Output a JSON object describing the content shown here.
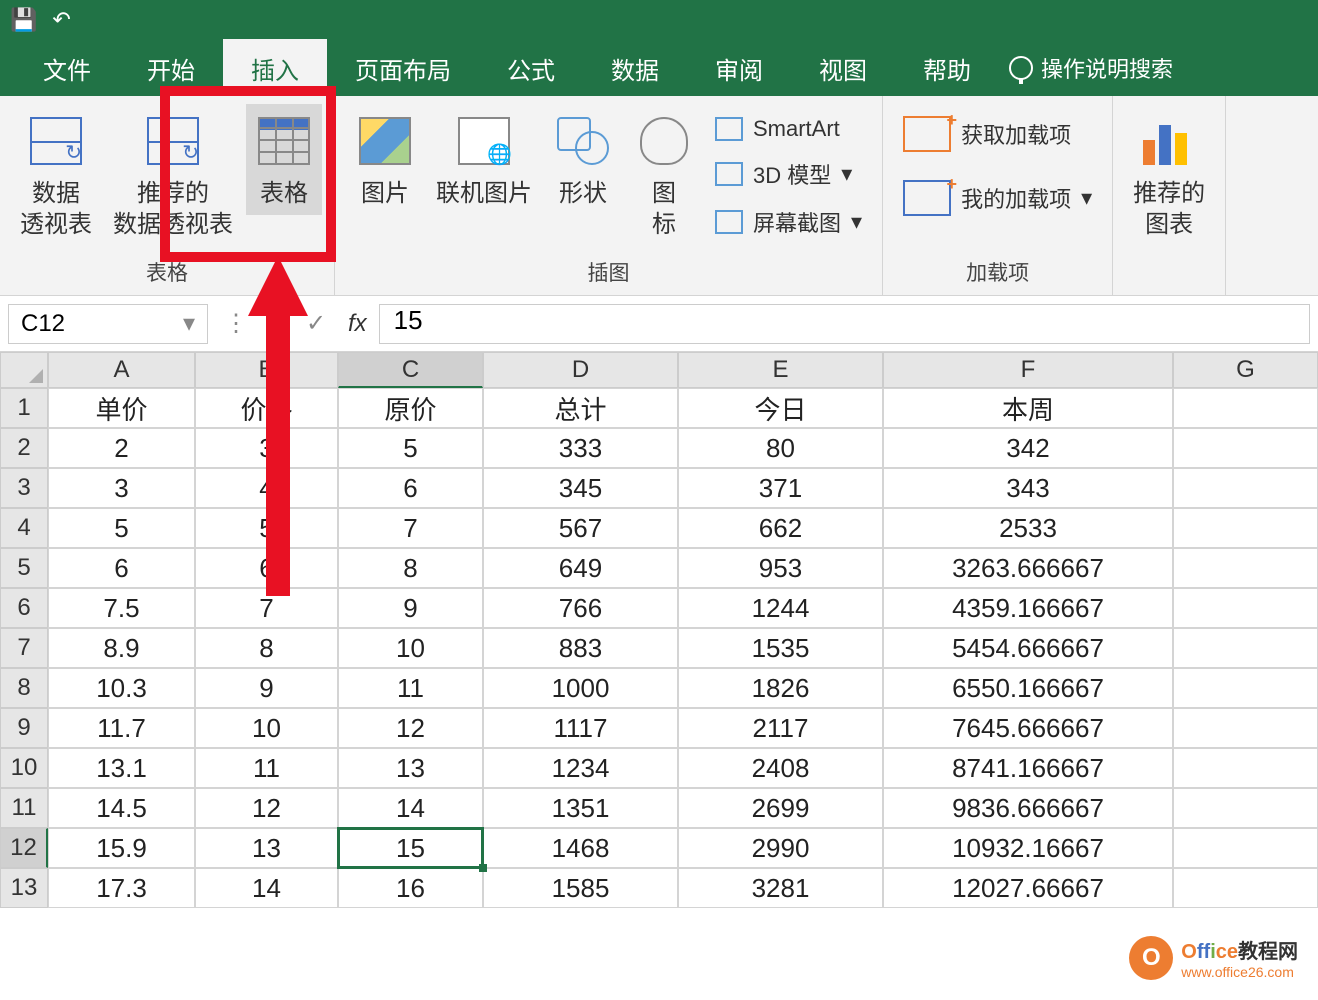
{
  "titlebar": {
    "save_icon": "💾",
    "undo_icon": "↶"
  },
  "tabs": {
    "file": "文件",
    "home": "开始",
    "insert": "插入",
    "pagelayout": "页面布局",
    "formulas": "公式",
    "data": "数据",
    "review": "审阅",
    "view": "视图",
    "help": "帮助",
    "tellme": "操作说明搜索"
  },
  "ribbon": {
    "tables": {
      "pivottable": "数据\n透视表",
      "recommended": "推荐的\n数据透视表",
      "table": "表格",
      "group": "表格"
    },
    "illustrations": {
      "picture": "图片",
      "online": "联机图片",
      "shapes": "形状",
      "icons": "图\n标",
      "smartart": "SmartArt",
      "model3d": "3D 模型",
      "screenshot": "屏幕截图",
      "group": "插图"
    },
    "addins": {
      "get": "获取加载项",
      "my": "我的加载项",
      "group": "加载项"
    },
    "charts": {
      "recommended": "推荐的\n图表"
    }
  },
  "formula_bar": {
    "name_box": "C12",
    "cancel": "✕",
    "enter": "✓",
    "fx": "fx",
    "value": "15"
  },
  "columns": [
    "A",
    "B",
    "C",
    "D",
    "E",
    "F",
    "G"
  ],
  "headers": {
    "A": "单价",
    "B": "价格",
    "C": "原价",
    "D": "总计",
    "E": "今日",
    "F": "本周"
  },
  "rows": [
    {
      "n": "1",
      "A": "单价",
      "B": "价格",
      "C": "原价",
      "D": "总计",
      "E": "今日",
      "F": "本周"
    },
    {
      "n": "2",
      "A": "2",
      "B": "3",
      "C": "5",
      "D": "333",
      "E": "80",
      "F": "342"
    },
    {
      "n": "3",
      "A": "3",
      "B": "4",
      "C": "6",
      "D": "345",
      "E": "371",
      "F": "343"
    },
    {
      "n": "4",
      "A": "5",
      "B": "5",
      "C": "7",
      "D": "567",
      "E": "662",
      "F": "2533"
    },
    {
      "n": "5",
      "A": "6",
      "B": "6",
      "C": "8",
      "D": "649",
      "E": "953",
      "F": "3263.666667"
    },
    {
      "n": "6",
      "A": "7.5",
      "B": "7",
      "C": "9",
      "D": "766",
      "E": "1244",
      "F": "4359.166667"
    },
    {
      "n": "7",
      "A": "8.9",
      "B": "8",
      "C": "10",
      "D": "883",
      "E": "1535",
      "F": "5454.666667"
    },
    {
      "n": "8",
      "A": "10.3",
      "B": "9",
      "C": "11",
      "D": "1000",
      "E": "1826",
      "F": "6550.166667"
    },
    {
      "n": "9",
      "A": "11.7",
      "B": "10",
      "C": "12",
      "D": "1117",
      "E": "2117",
      "F": "7645.666667"
    },
    {
      "n": "10",
      "A": "13.1",
      "B": "11",
      "C": "13",
      "D": "1234",
      "E": "2408",
      "F": "8741.166667"
    },
    {
      "n": "11",
      "A": "14.5",
      "B": "12",
      "C": "14",
      "D": "1351",
      "E": "2699",
      "F": "9836.666667"
    },
    {
      "n": "12",
      "A": "15.9",
      "B": "13",
      "C": "15",
      "D": "1468",
      "E": "2990",
      "F": "10932.16667"
    },
    {
      "n": "13",
      "A": "17.3",
      "B": "14",
      "C": "16",
      "D": "1585",
      "E": "3281",
      "F": "12027.66667"
    }
  ],
  "selected": {
    "row": "12",
    "col": "C"
  },
  "watermark": {
    "title_1": "O",
    "title_2": "ff",
    "title_3": "i",
    "title_4": "ce",
    "title_5": "教程网",
    "url": "www.office26.com",
    "icon": "O"
  }
}
